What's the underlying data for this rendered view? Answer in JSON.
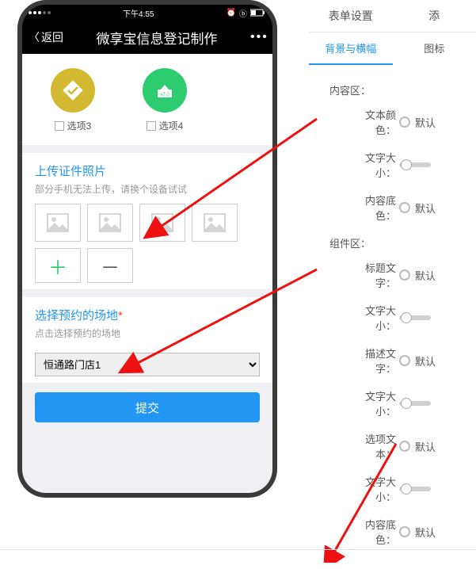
{
  "phone": {
    "status": {
      "time": "下午4:55"
    },
    "nav": {
      "back": "返回",
      "title": "微享宝信息登记制作"
    },
    "options": {
      "opt3": "选项3",
      "opt4": "选项4"
    },
    "upload": {
      "title": "上传证件照片",
      "subtitle": "部分手机无法上传，请换个设备试试"
    },
    "venue": {
      "title": "选择预约的场地",
      "subtitle": "点击选择预约的场地",
      "selected": "恒通路门店1"
    },
    "submit": "提交",
    "green_badge_text": "v7.0"
  },
  "settings": {
    "tabs1": {
      "form": "表单设置",
      "add": "添"
    },
    "tabs2": {
      "bg": "背景与横幅",
      "icon": "图标"
    },
    "content_section": "内容区：",
    "component_section": "组件区：",
    "rows": {
      "text_color": "文本颜色：",
      "font_size": "文字大小：",
      "bg_color": "内容底色：",
      "title_text": "标题文字：",
      "desc_text": "描述文字：",
      "option_text": "选项文本：",
      "default": "默认"
    }
  }
}
